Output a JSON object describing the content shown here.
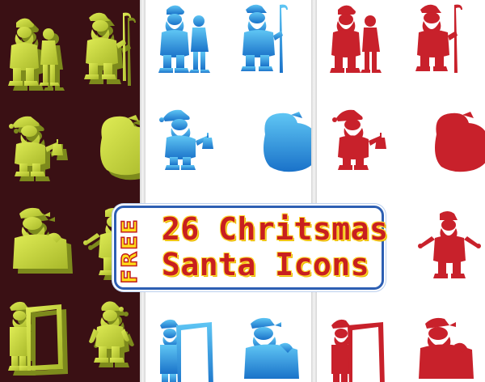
{
  "banner": {
    "free_label": "FREE",
    "title_line1": "26 Chritsmas",
    "title_line2": "Santa Icons"
  },
  "colors": {
    "dark_background": "#3a1014",
    "lime_icon": "#c8d83a",
    "blue_icon": "#2e9fe0",
    "red_icon": "#c8212b",
    "banner_border": "#2d5fb3",
    "banner_text": "#c81f1f",
    "free_text": "#ffdd1a"
  },
  "panels": [
    {
      "name": "lime-3d-santa-panel",
      "icon_count": 8
    },
    {
      "name": "blue-gradient-santa-panel",
      "icon_count": 8
    },
    {
      "name": "red-santa-panel",
      "icon_count": 8
    }
  ]
}
